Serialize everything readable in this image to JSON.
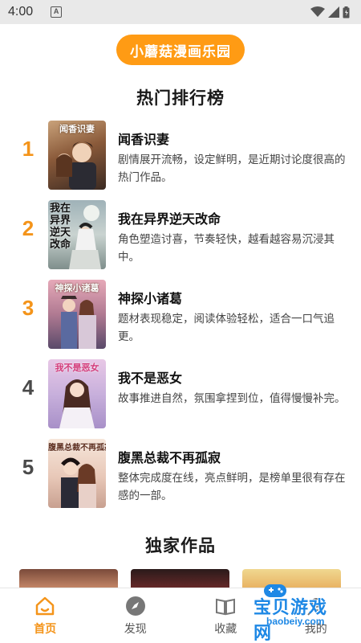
{
  "status_bar": {
    "time": "4:00",
    "a_badge": "A"
  },
  "brand": {
    "label": "小蘑菇漫画乐园"
  },
  "ranking": {
    "title": "热门排行榜",
    "items": [
      {
        "rank": "1",
        "title": "闻香识妻",
        "cover_text": "闻香识妻",
        "desc": "剧情展开流畅，设定鲜明，是近期讨论度很高的热门作品。",
        "color": "#f4941a"
      },
      {
        "rank": "2",
        "title": "我在异界逆天改命",
        "cover_text": "我在异界逆天改命",
        "desc": "角色塑造讨喜，节奏轻快，越看越容易沉浸其中。",
        "color": "#f4941a"
      },
      {
        "rank": "3",
        "title": "神探小诸葛",
        "cover_text": "神探小诸葛",
        "desc": "题材表现稳定，阅读体验轻松，适合一口气追更。",
        "color": "#f4941a"
      },
      {
        "rank": "4",
        "title": "我不是恶女",
        "cover_text": "我不是恶女",
        "desc": "故事推进自然，氛围拿捏到位，值得慢慢补完。",
        "color": "#4a4a4a"
      },
      {
        "rank": "5",
        "title": "腹黑总裁不再孤寂",
        "cover_text": "腹黑总裁不再孤寂",
        "desc": "整体完成度在线，亮点鲜明，是榜单里很有存在感的一部。",
        "color": "#4a4a4a"
      }
    ]
  },
  "exclusive": {
    "title": "独家作品"
  },
  "bottom_nav": {
    "items": [
      {
        "label": "首页",
        "icon": "home-icon",
        "active": true
      },
      {
        "label": "发现",
        "icon": "compass-icon",
        "active": false
      },
      {
        "label": "收藏",
        "icon": "book-icon",
        "active": false
      },
      {
        "label": "我的",
        "icon": "user-icon",
        "active": false
      }
    ]
  },
  "watermark": {
    "text": "宝贝游戏网",
    "url": "baobeiy.com"
  }
}
